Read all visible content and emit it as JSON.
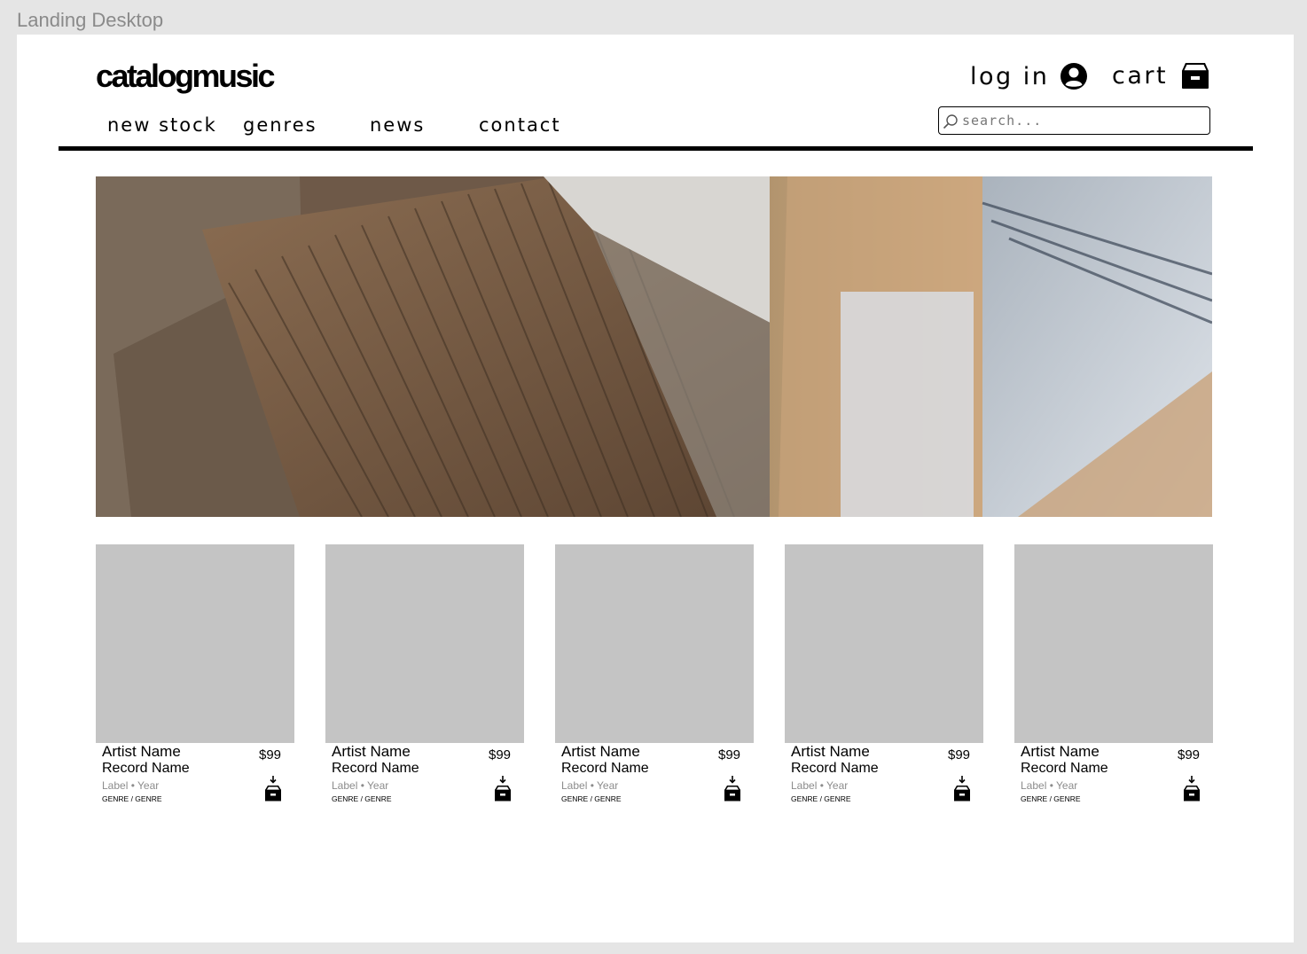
{
  "frame": {
    "label": "Landing Desktop"
  },
  "header": {
    "logo": "catalogmusic",
    "login_label": "log in",
    "cart_label": "cart",
    "nav": [
      {
        "label": "new stock"
      },
      {
        "label": "genres"
      },
      {
        "label": "news"
      },
      {
        "label": "contact"
      }
    ],
    "search": {
      "placeholder": "search...",
      "value": "",
      "icon": "search-icon"
    }
  },
  "hero": {
    "image": "record-crates-photo"
  },
  "products": [
    {
      "artist": "Artist Name",
      "record": "Record Name",
      "meta": "Label • Year",
      "genre": "GENRE / GENRE",
      "price": "$99"
    },
    {
      "artist": "Artist Name",
      "record": "Record Name",
      "meta": "Label • Year",
      "genre": "GENRE / GENRE",
      "price": "$99"
    },
    {
      "artist": "Artist Name",
      "record": "Record Name",
      "meta": "Label • Year",
      "genre": "GENRE / GENRE",
      "price": "$99"
    },
    {
      "artist": "Artist Name",
      "record": "Record Name",
      "meta": "Label • Year",
      "genre": "GENRE / GENRE",
      "price": "$99"
    },
    {
      "artist": "Artist Name",
      "record": "Record Name",
      "meta": "Label • Year",
      "genre": "GENRE / GENRE",
      "price": "$99"
    }
  ],
  "colors": {
    "background": "#e5e5e5",
    "canvas": "#ffffff",
    "placeholder": "#c4c4c4",
    "text": "#000000",
    "muted": "#8c8c8c"
  }
}
